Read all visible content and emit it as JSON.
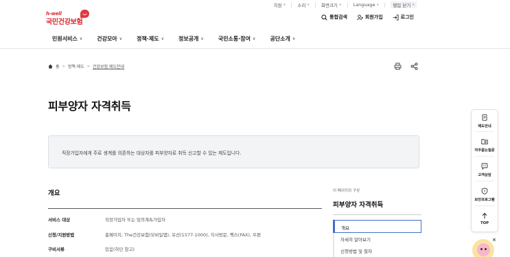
{
  "utility_bar": {
    "items": [
      "지원",
      "소리",
      "화면크기",
      "Language"
    ],
    "fold": "펼입 닫기"
  },
  "logo": {
    "tagline": "h-well",
    "name": "국민건강보험"
  },
  "header_actions": {
    "search": "통합검색",
    "join": "회원가입",
    "login": "로그인"
  },
  "main_nav": [
    "민원서비스",
    "건강모아",
    "정책·제도",
    "정보공개",
    "국민소통·참여",
    "공단소개"
  ],
  "breadcrumb": {
    "home": "홈",
    "level1": "정책·제도",
    "level2": "건강보험 제도안내"
  },
  "page": {
    "title": "피부양자 자격취득",
    "summary": "직장가입자에게 주로 생계를 의존하는 대상자를 피부양자로 취득 신고할 수 있는 제도입니다.",
    "overview_heading": "개요",
    "rows": [
      {
        "key": "서비스 대상",
        "value": "직장가입자 또는 임의계속가입자"
      },
      {
        "key": "신청/지원방법",
        "value": "홈페이지, The건강보험(모바일앱), 유선(1577-1000), 지사방문, 팩스(FAX), 우편"
      },
      {
        "key": "구비서류",
        "value": "있음(하단 참고)"
      }
    ]
  },
  "toc": {
    "caption": "이 페이지의 구성",
    "title": "피부양자 자격취득",
    "items": [
      "개요",
      "자세히 알아보기",
      "신청방법 및 절차"
    ],
    "active_index": 0
  },
  "quick_menu": {
    "items": [
      "제도안내",
      "자주묻는질문",
      "고객상담",
      "보안프로그램"
    ],
    "top": "TOP"
  },
  "chatbot_close": "×",
  "colors": {
    "brand_red": "#d8262e",
    "accent_blue": "#3f6ec7",
    "summary_bg": "#f3f4f6"
  }
}
